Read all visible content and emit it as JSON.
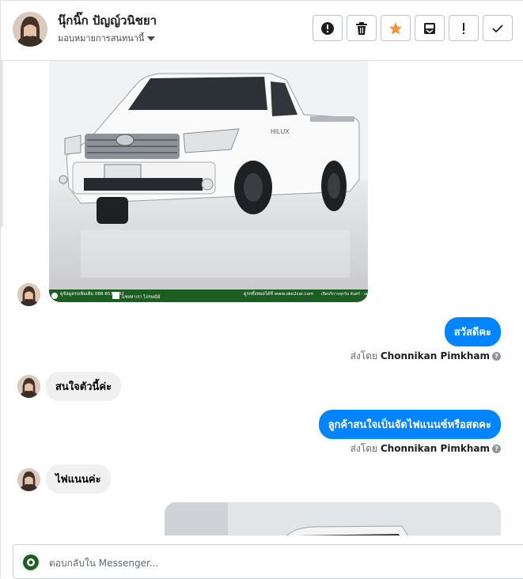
{
  "header": {
    "contact_name": "นุ๊กนิ๊ก ปัญญ์วนิชยา",
    "assign_label": "มอบหมายการสนทนานี้",
    "tools": [
      {
        "icon": "alert-circle-icon",
        "action": "mark-spam"
      },
      {
        "icon": "trash-icon",
        "action": "delete"
      },
      {
        "icon": "star-icon",
        "action": "star"
      },
      {
        "icon": "archive-box-icon",
        "action": "move"
      },
      {
        "icon": "exclamation-icon",
        "action": "mark-follow-up"
      },
      {
        "icon": "checkmark-icon",
        "action": "mark-done"
      }
    ]
  },
  "car_ad": {
    "badge": "HILUX",
    "footer_texts": [
      "ดูข้อมูลรถเพิ่มเติม 088-8577832",
      "แชทหาเรา ไปรษณีย์",
      "ดูรถทั้งหมดได้ที่ www.oko2car.com",
      "เปิดบริการทุกวัน จันทร์ - เสาร์ 08.00 - 17.00"
    ]
  },
  "messages": [
    {
      "side": "out",
      "text": "สวัสดีคะ",
      "sent_by_prefix": "ส่งโดย",
      "sender": "Chonnikan Pimkham"
    },
    {
      "side": "in",
      "text": "สนใจตัวนี้ค่ะ"
    },
    {
      "side": "out",
      "text": "ลูกค้าสนใจเป็นจัดไฟแนนซ์หรือสดคะ",
      "sent_by_prefix": "ส่งโดย",
      "sender": "Chonnikan Pimkham"
    },
    {
      "side": "in",
      "text": "ไฟแนนค่ะ"
    }
  ],
  "composer": {
    "placeholder": "ตอบกลับใน Messenger..."
  },
  "colors": {
    "accent": "#0084ff",
    "star": "#f7923b",
    "footer_green": "#1b5e20"
  }
}
